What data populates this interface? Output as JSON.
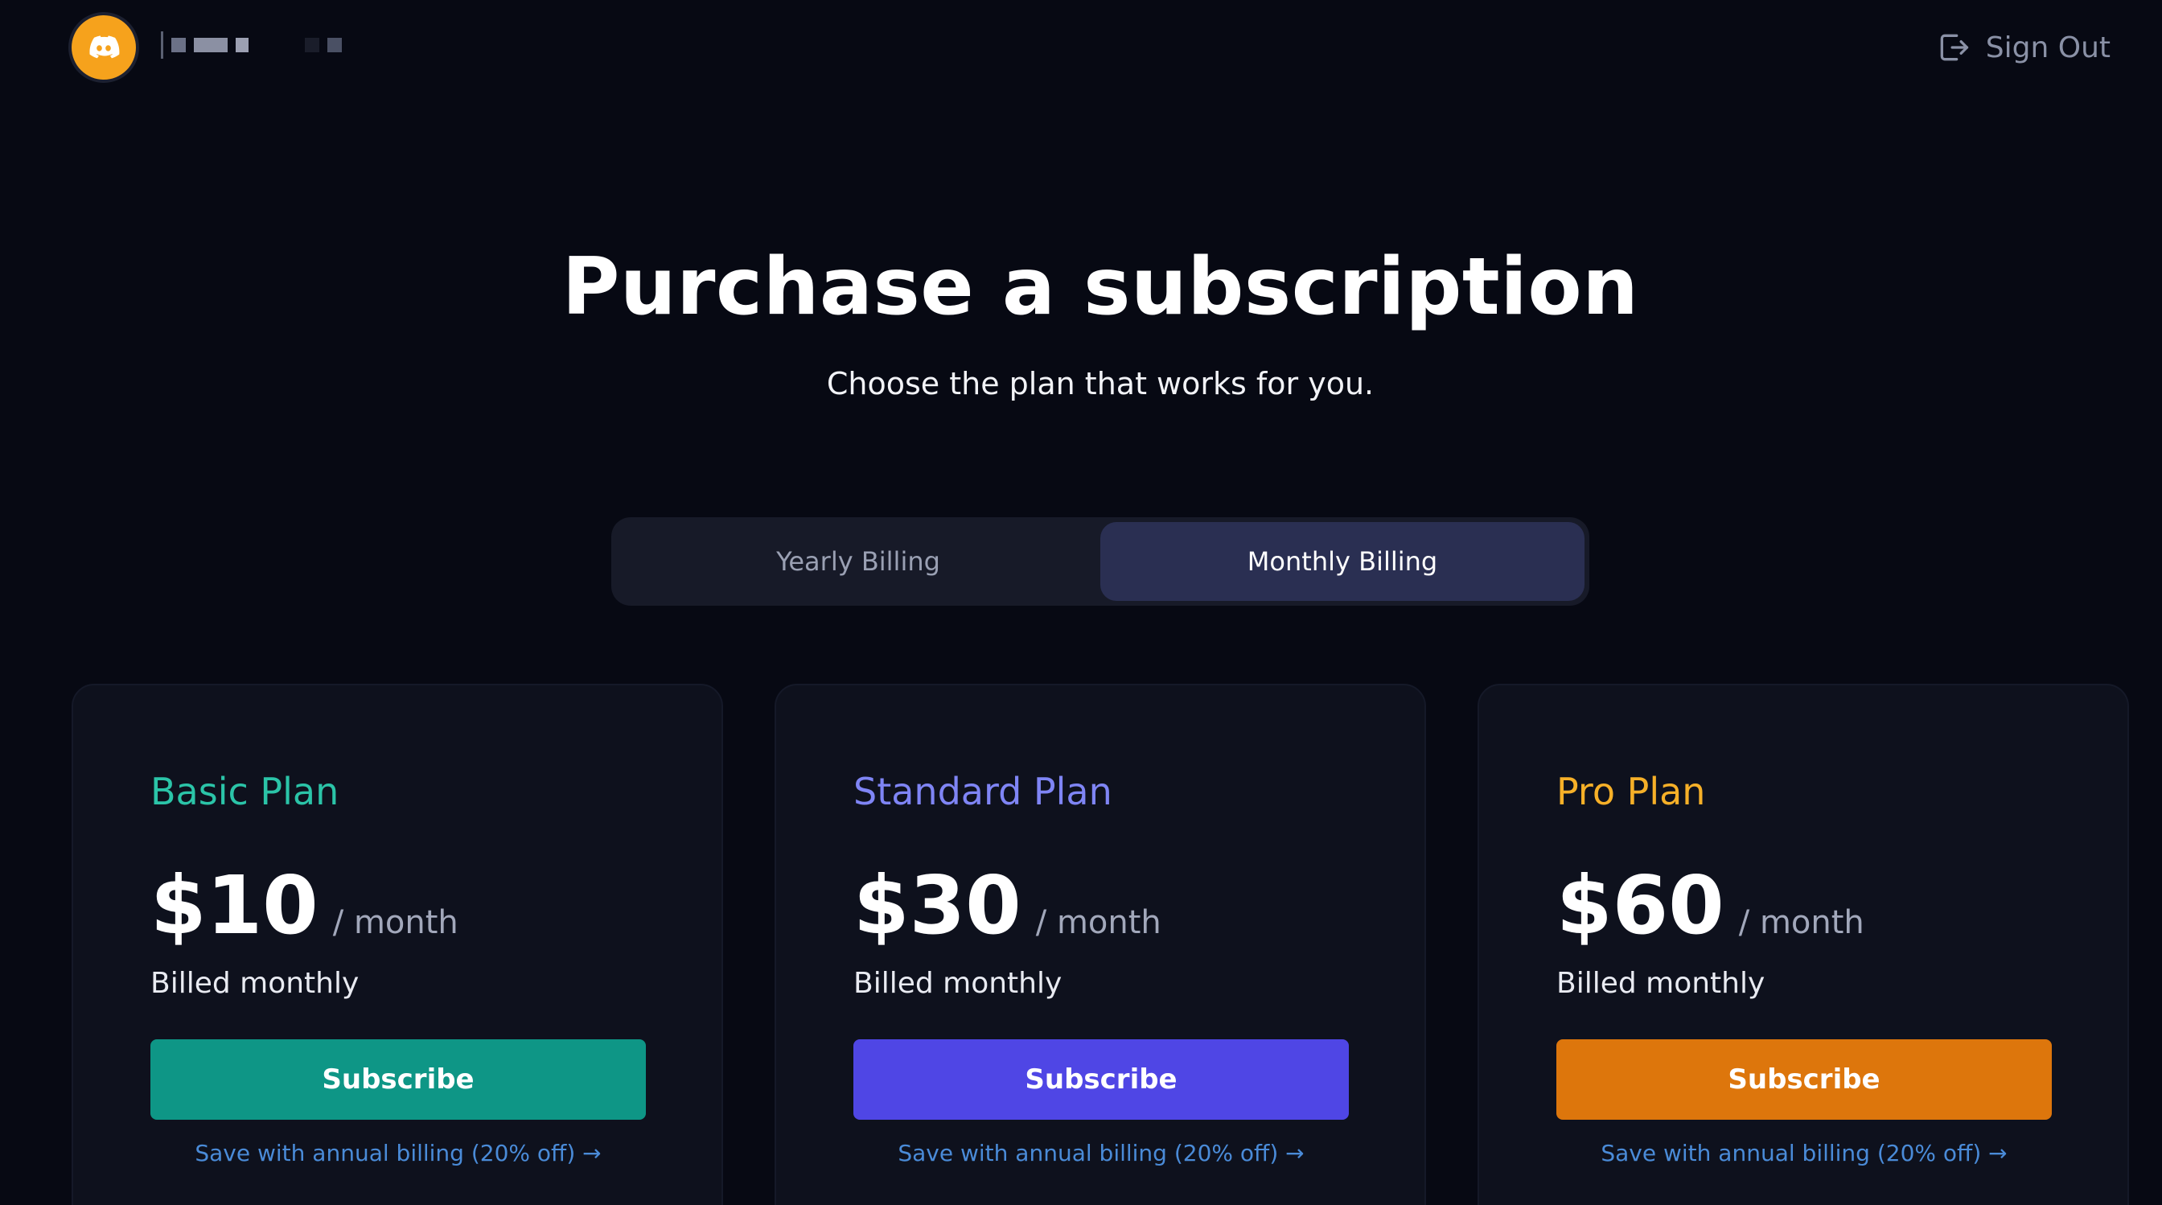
{
  "header": {
    "avatar_icon": "discord-logo-icon",
    "signout_icon": "sign-out-icon",
    "signout_label": "Sign Out"
  },
  "hero": {
    "title": "Purchase a subscription",
    "subtitle": "Choose the plan that works for you."
  },
  "billing": {
    "options": [
      {
        "label": "Yearly Billing",
        "active": false
      },
      {
        "label": "Monthly Billing",
        "active": true
      }
    ]
  },
  "plans": [
    {
      "name": "Basic Plan",
      "price": "$10",
      "period": "/ month",
      "billed": "Billed monthly",
      "cta": "Subscribe",
      "save": "Save with annual billing (20% off) →",
      "accent": "#2bc4a8",
      "button_color": "#0e9686"
    },
    {
      "name": "Standard Plan",
      "price": "$30",
      "period": "/ month",
      "billed": "Billed monthly",
      "cta": "Subscribe",
      "save": "Save with annual billing (20% off) →",
      "accent": "#7f85f5",
      "button_color": "#4f46e5"
    },
    {
      "name": "Pro Plan",
      "price": "$60",
      "period": "/ month",
      "billed": "Billed monthly",
      "cta": "Subscribe",
      "save": "Save with annual billing (20% off) →",
      "accent": "#f6b028",
      "button_color": "#dd760c"
    }
  ],
  "colors": {
    "background": "#070913",
    "card": "#0e111d",
    "link": "#4a8bd8"
  }
}
